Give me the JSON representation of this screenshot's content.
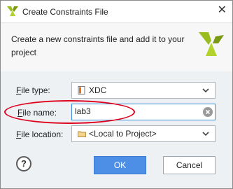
{
  "window": {
    "title": "Create Constraints File",
    "close_glyph": "✕"
  },
  "header": {
    "description": "Create a new constraints file and add it to your project"
  },
  "form": {
    "file_type": {
      "label_accel": "F",
      "label_rest": "ile type:",
      "value": "XDC",
      "icon": "xdc-file-icon"
    },
    "file_name": {
      "label_accel": "F",
      "label_rest": "ile name:",
      "value": "lab3"
    },
    "file_location": {
      "label_accel": "F",
      "label_rest": "ile location:",
      "value": "<Local to Project>",
      "icon": "folder-icon"
    }
  },
  "buttons": {
    "help": "?",
    "ok": "OK",
    "cancel": "Cancel"
  },
  "colors": {
    "accent": "#4d8fe6",
    "annotation": "#e0001b",
    "vivado_logo": "#9bbc1f"
  }
}
